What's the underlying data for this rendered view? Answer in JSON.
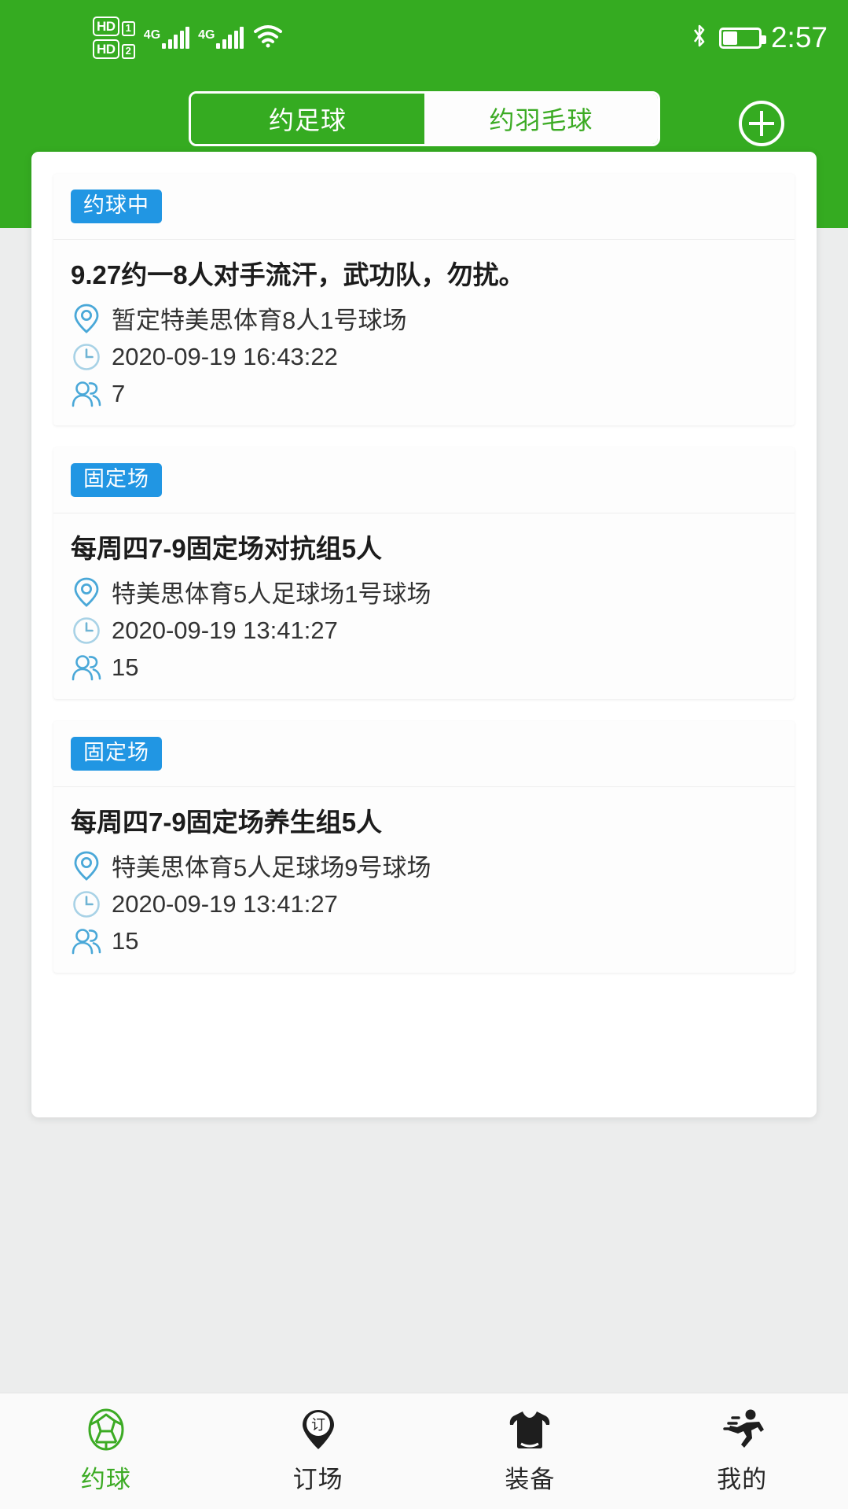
{
  "status_bar": {
    "hd_labels": [
      "HD",
      "HD"
    ],
    "sim_numbers": [
      "1",
      "2"
    ],
    "network_labels": [
      "4G",
      "4G"
    ],
    "wifi_icon": "wifi-icon",
    "bluetooth_icon": "bluetooth-icon",
    "battery_icon": "battery-icon",
    "battery_level_pct": 40,
    "time": "2:57"
  },
  "header": {
    "tabs": [
      {
        "label": "约足球",
        "active": true
      },
      {
        "label": "约羽毛球",
        "active": false
      }
    ],
    "add_button_icon": "plus-circle-icon",
    "accent_green": "#35ab21"
  },
  "colors": {
    "green": "#35ab21",
    "blue_badge": "#2196e3",
    "icon_blue": "#4aa8d8",
    "page_bg": "#eceded"
  },
  "main": {
    "cards": [
      {
        "badge": "约球中",
        "title": "9.27约一8人对手流汗，武功队，勿扰。",
        "location_icon": "location-pin-icon",
        "location": "暂定特美思体育8人1号球场",
        "time_icon": "clock-icon",
        "time": "2020-09-19 16:43:22",
        "people_icon": "people-icon",
        "people": "7"
      },
      {
        "badge": "固定场",
        "title": "每周四7-9固定场对抗组5人",
        "location_icon": "location-pin-icon",
        "location": "特美思体育5人足球场1号球场",
        "time_icon": "clock-icon",
        "time": "2020-09-19 13:41:27",
        "people_icon": "people-icon",
        "people": "15"
      },
      {
        "badge": "固定场",
        "title": "每周四7-9固定场养生组5人",
        "location_icon": "location-pin-icon",
        "location": "特美思体育5人足球场9号球场",
        "time_icon": "clock-icon",
        "time": "2020-09-19 13:41:27",
        "people_icon": "people-icon",
        "people": "15"
      }
    ]
  },
  "bottom_nav": {
    "items": [
      {
        "label": "约球",
        "icon": "football-icon",
        "active": true
      },
      {
        "label": "订场",
        "icon": "booking-pin-icon",
        "active": false
      },
      {
        "label": "装备",
        "icon": "jersey-icon",
        "active": false
      },
      {
        "label": "我的",
        "icon": "running-person-icon",
        "active": false
      }
    ]
  }
}
